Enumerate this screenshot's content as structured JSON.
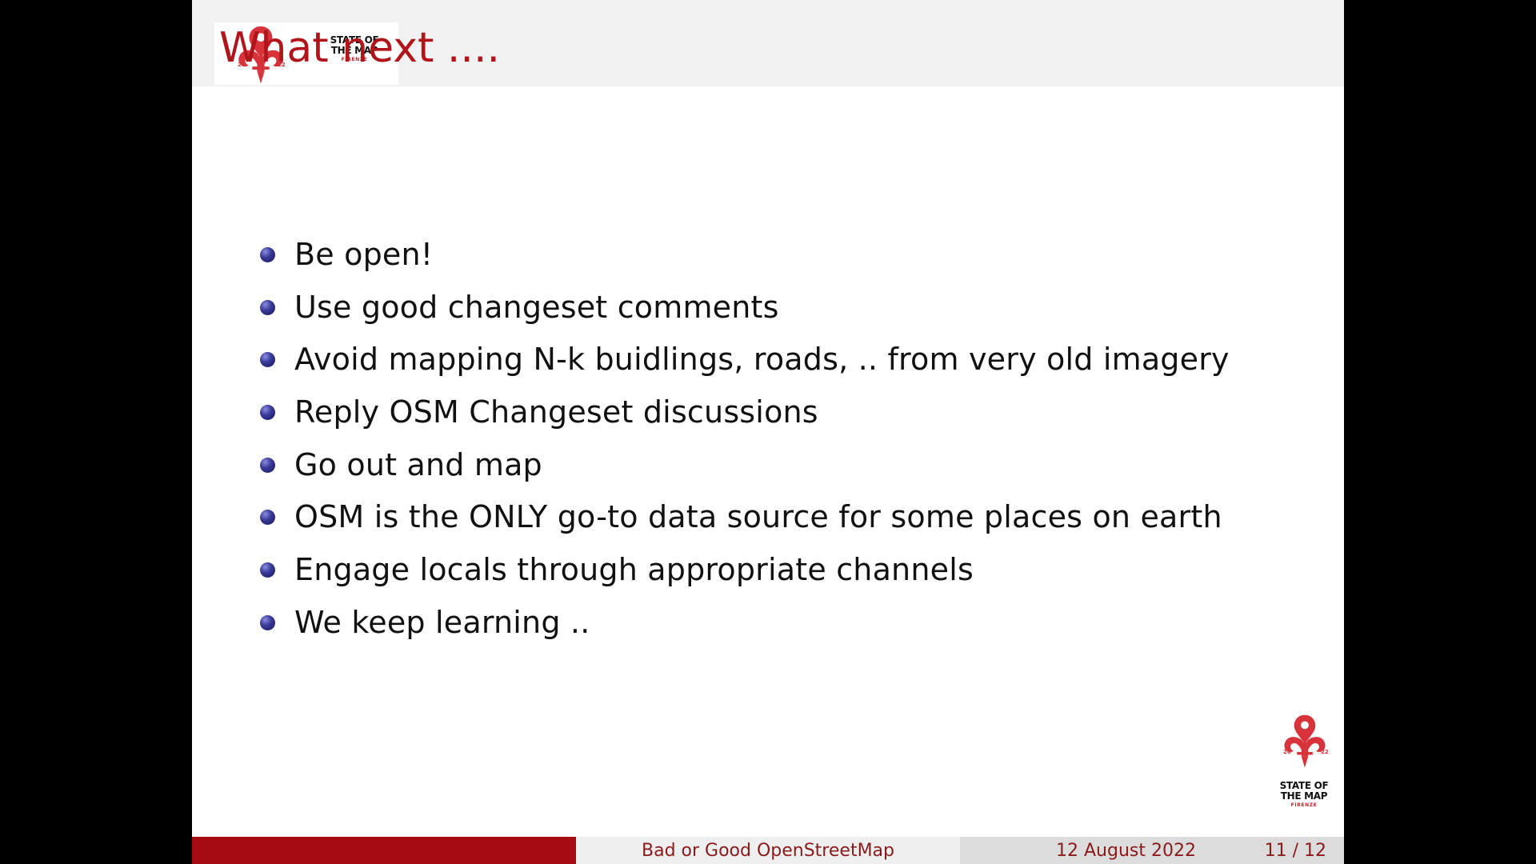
{
  "slide": {
    "title": "What next ....",
    "bullets": [
      "Be open!",
      "Use good changeset comments",
      "Avoid mapping N-k buidlings, roads, .. from very old imagery",
      "Reply OSM Changeset discussions",
      "Go out and map",
      "OSM is the ONLY go-to data source for some places on earth",
      "Engage locals through appropriate channels",
      "We keep learning .."
    ]
  },
  "logo": {
    "line1": "STATE OF",
    "line2": "THE MAP",
    "line3": "FIRENZE",
    "year_left": "20",
    "year_right": "22"
  },
  "footer": {
    "talk_title": "Bad or Good OpenStreetMap",
    "date": "12 August 2022",
    "page": "11 / 12"
  },
  "colors": {
    "title": "#b0151b",
    "logo_red": "#d8333a",
    "footer_red": "#a30d12",
    "bullet": "#2c2c8a"
  },
  "icons": {
    "logo": "fleur-de-lis-map-pin-icon",
    "bullet": "sphere-bullet-icon"
  }
}
